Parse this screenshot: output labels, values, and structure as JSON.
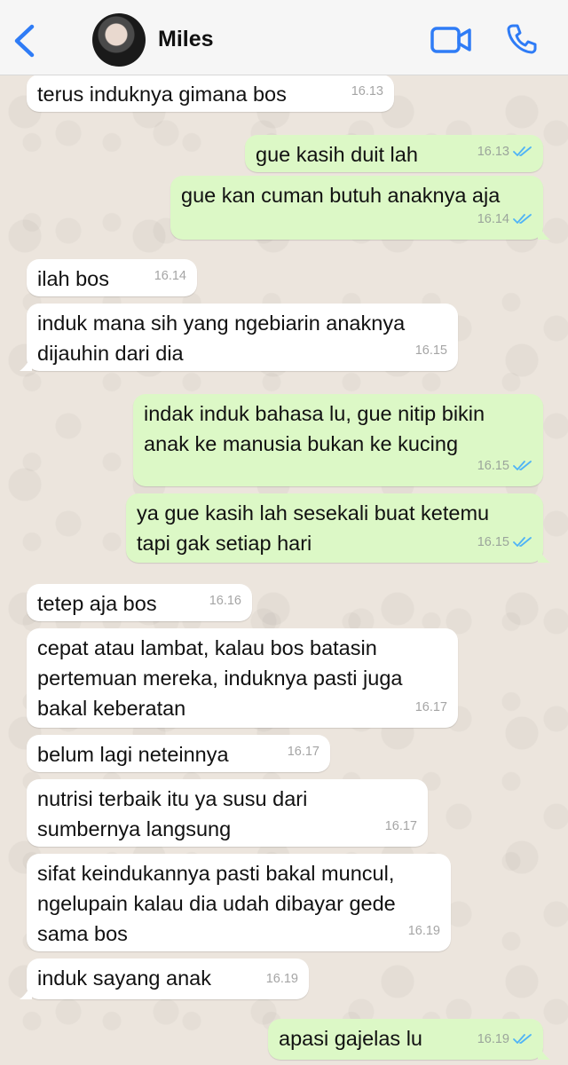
{
  "header": {
    "contact_name": "Miles",
    "back_icon": "chevron-left-icon",
    "video_icon": "video-call-icon",
    "phone_icon": "phone-call-icon",
    "accent": "#2f7cf6"
  },
  "colors": {
    "incoming_bubble": "#ffffff",
    "outgoing_bubble": "#dcf8c6",
    "read_tick": "#4fb3f6"
  },
  "messages": [
    {
      "dir": "in",
      "text": "terus induknya gimana bos",
      "time": "16.13"
    },
    {
      "dir": "out",
      "text": "gue kasih duit lah",
      "time": "16.13"
    },
    {
      "dir": "out",
      "text": "gue kan cuman butuh anaknya aja",
      "time": "16.14"
    },
    {
      "dir": "in",
      "text": "ilah bos",
      "time": "16.14"
    },
    {
      "dir": "in",
      "text": "induk mana sih yang ngebiarin anaknya\ndijauhin dari dia",
      "time": "16.15"
    },
    {
      "dir": "out",
      "text": "indak induk bahasa lu, gue nitip bikin\nanak ke manusia bukan ke kucing",
      "time": "16.15"
    },
    {
      "dir": "out",
      "text": "ya gue kasih lah sesekali buat ketemu\ntapi gak setiap hari",
      "time": "16.15"
    },
    {
      "dir": "in",
      "text": "tetep aja bos",
      "time": "16.16"
    },
    {
      "dir": "in",
      "text": "cepat atau lambat, kalau bos batasin\npertemuan mereka, induknya pasti juga\nbakal keberatan",
      "time": "16.17"
    },
    {
      "dir": "in",
      "text": "belum lagi neteinnya",
      "time": "16.17"
    },
    {
      "dir": "in",
      "text": "nutrisi terbaik itu ya susu dari\nsumbernya langsung",
      "time": "16.17"
    },
    {
      "dir": "in",
      "text": "sifat keindukannya pasti bakal muncul,\nngelupain kalau dia udah dibayar gede\nsama bos",
      "time": "16.19"
    },
    {
      "dir": "in",
      "text": "induk sayang anak",
      "time": "16.19"
    },
    {
      "dir": "out",
      "text": "apasi gajelas lu",
      "time": "16.19"
    }
  ]
}
